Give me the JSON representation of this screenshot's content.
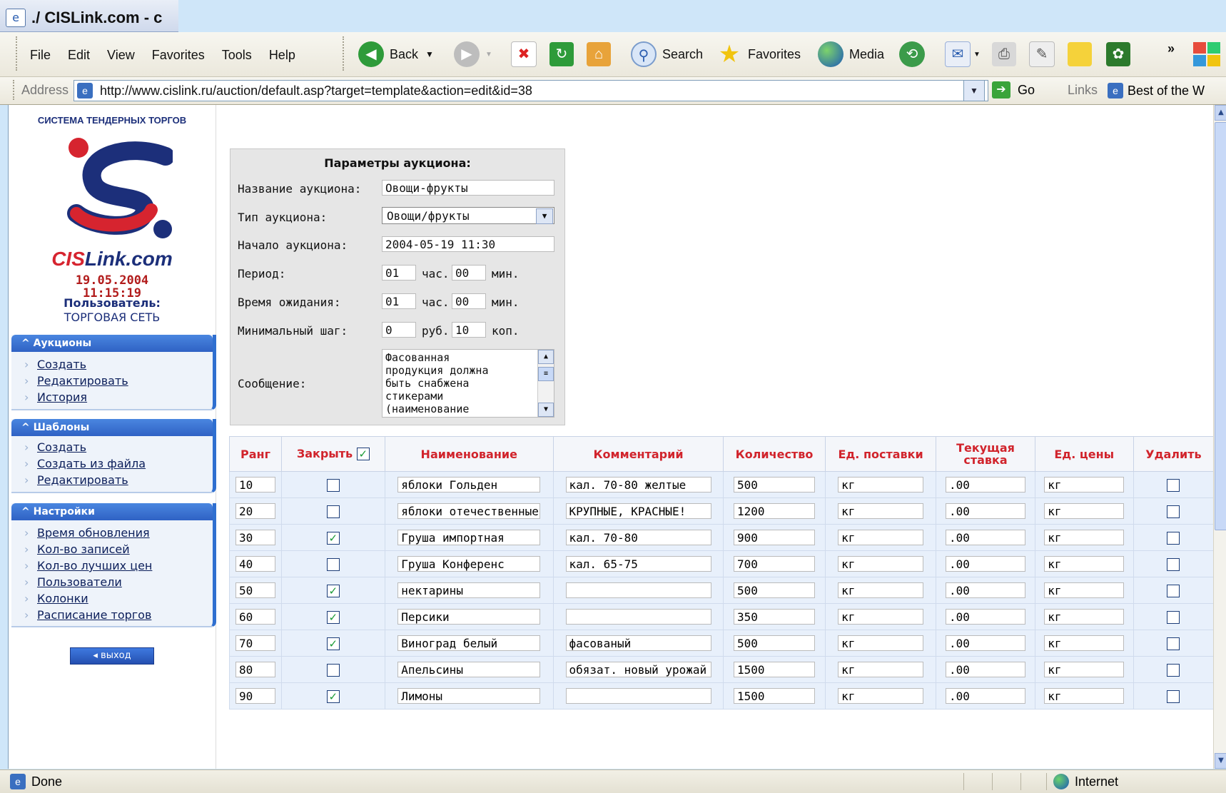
{
  "window": {
    "title": "./ CISLink.com - с"
  },
  "menu": [
    "File",
    "Edit",
    "View",
    "Favorites",
    "Tools",
    "Help"
  ],
  "toolbar": {
    "back": "Back",
    "search": "Search",
    "favorites": "Favorites",
    "media": "Media"
  },
  "address": {
    "label": "Address",
    "url": "http://www.cislink.ru/auction/default.asp?target=template&action=edit&id=38",
    "go": "Go",
    "links": "Links",
    "best": "Best of the W"
  },
  "status": {
    "text": "Done",
    "zone": "Internet"
  },
  "sidebar": {
    "brand": "СИСТЕМА ТЕНДЕРНЫХ ТОРГОВ",
    "logo_a": "CIS",
    "logo_b": "Link.com",
    "date": "19.05.2004",
    "time": "11:15:19",
    "user_label": "Пользователь:",
    "user_name": "ТОРГОВАЯ СЕТЬ",
    "sections": [
      {
        "title": "Аукционы",
        "items": [
          "Создать",
          "Редактировать",
          "История"
        ]
      },
      {
        "title": "Шаблоны",
        "items": [
          "Создать",
          "Создать из файла",
          "Редактировать"
        ]
      },
      {
        "title": "Настройки",
        "items": [
          "Время обновления",
          "Кол-во записей",
          "Кол-во лучших цен",
          "Пользователи",
          "Колонки",
          "Расписание торгов"
        ]
      }
    ],
    "exit": "выход"
  },
  "params": {
    "heading": "Параметры аукциона:",
    "name_label": "Название аукциона:",
    "name_value": "Овощи-фрукты",
    "type_label": "Тип аукциона:",
    "type_value": "Овощи/фрукты",
    "start_label": "Начало аукциона:",
    "start_value": "2004-05-19 11:30",
    "period_label": "Период:",
    "period_h": "01",
    "period_m": "00",
    "wait_label": "Время ожидания:",
    "wait_h": "01",
    "wait_m": "00",
    "hours_unit": "час.",
    "minutes_unit": "мин.",
    "step_label": "Минимальный шаг:",
    "step_rub": "0",
    "step_kop": "10",
    "rub_unit": "руб.",
    "kop_unit": "коп.",
    "message_label": "Сообщение:",
    "message_value": "Фасованная\nпродукция должна\nбыть снабжена\nстикерами\n(наименование"
  },
  "table": {
    "headers": [
      "Ранг",
      "Закрыть",
      "Наименование",
      "Комментарий",
      "Количество",
      "Ед. поставки",
      "Текущая ставка",
      "Ед. цены",
      "Удалить"
    ],
    "rows": [
      {
        "rank": "10",
        "close": false,
        "name": "яблоки Гольден",
        "comment": "кал. 70-80 желтые",
        "qty": "500",
        "unit": "кг",
        "bid": ".00",
        "price_unit": "кг",
        "del": false
      },
      {
        "rank": "20",
        "close": false,
        "name": "яблоки отечественные",
        "comment": "КРУПНЫЕ, КРАСНЫЕ!",
        "qty": "1200",
        "unit": "кг",
        "bid": ".00",
        "price_unit": "кг",
        "del": false
      },
      {
        "rank": "30",
        "close": true,
        "name": "Груша импортная",
        "comment": "кал. 70-80",
        "qty": "900",
        "unit": "кг",
        "bid": ".00",
        "price_unit": "кг",
        "del": false
      },
      {
        "rank": "40",
        "close": false,
        "name": "Груша Конференс",
        "comment": "кал. 65-75",
        "qty": "700",
        "unit": "кг",
        "bid": ".00",
        "price_unit": "кг",
        "del": false
      },
      {
        "rank": "50",
        "close": true,
        "name": "нектарины",
        "comment": "",
        "qty": "500",
        "unit": "кг",
        "bid": ".00",
        "price_unit": "кг",
        "del": false
      },
      {
        "rank": "60",
        "close": true,
        "name": "Персики",
        "comment": "",
        "qty": "350",
        "unit": "кг",
        "bid": ".00",
        "price_unit": "кг",
        "del": false
      },
      {
        "rank": "70",
        "close": true,
        "name": "Виноград белый",
        "comment": "фасованый",
        "qty": "500",
        "unit": "кг",
        "bid": ".00",
        "price_unit": "кг",
        "del": false
      },
      {
        "rank": "80",
        "close": false,
        "name": "Апельсины",
        "comment": "обязат. новый урожай",
        "qty": "1500",
        "unit": "кг",
        "bid": ".00",
        "price_unit": "кг",
        "del": false
      },
      {
        "rank": "90",
        "close": true,
        "name": "Лимоны",
        "comment": "",
        "qty": "1500",
        "unit": "кг",
        "bid": ".00",
        "price_unit": "кг",
        "del": false
      }
    ]
  }
}
